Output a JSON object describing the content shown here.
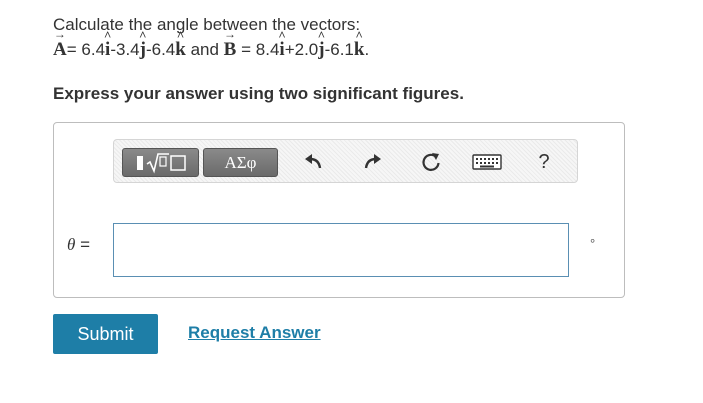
{
  "question": {
    "intro": "Calculate the angle between the vectors:",
    "vecA_letter": "A",
    "eq_sign": "=",
    "a_i_coef": "6.4",
    "a_j_coef": "-3.4",
    "a_k_coef": "-6.4",
    "conjunction": "and",
    "vecB_letter": "B",
    "eq_sign_b": "=",
    "b_i_coef": "8.4",
    "b_j_coef": "+2.0",
    "b_k_coef": "-6.1",
    "unit_i": "i",
    "unit_j": "j",
    "unit_k": "k",
    "end": "."
  },
  "instruction": "Express your answer using two significant figures.",
  "toolbar": {
    "templates_icon": "templates-sqrt-icon",
    "greek_label": "ΑΣφ",
    "undo_icon": "undo-icon",
    "redo_icon": "redo-icon",
    "reset_icon": "reset-icon",
    "keyboard_icon": "keyboard-icon",
    "help_label": "?"
  },
  "answer": {
    "variable": "θ",
    "equals": "=",
    "value": "",
    "unit": "°"
  },
  "actions": {
    "submit": "Submit",
    "request": "Request Answer"
  },
  "colors": {
    "accent": "#1e7ea7",
    "text": "#333333",
    "toolbar_button": "#777777"
  }
}
